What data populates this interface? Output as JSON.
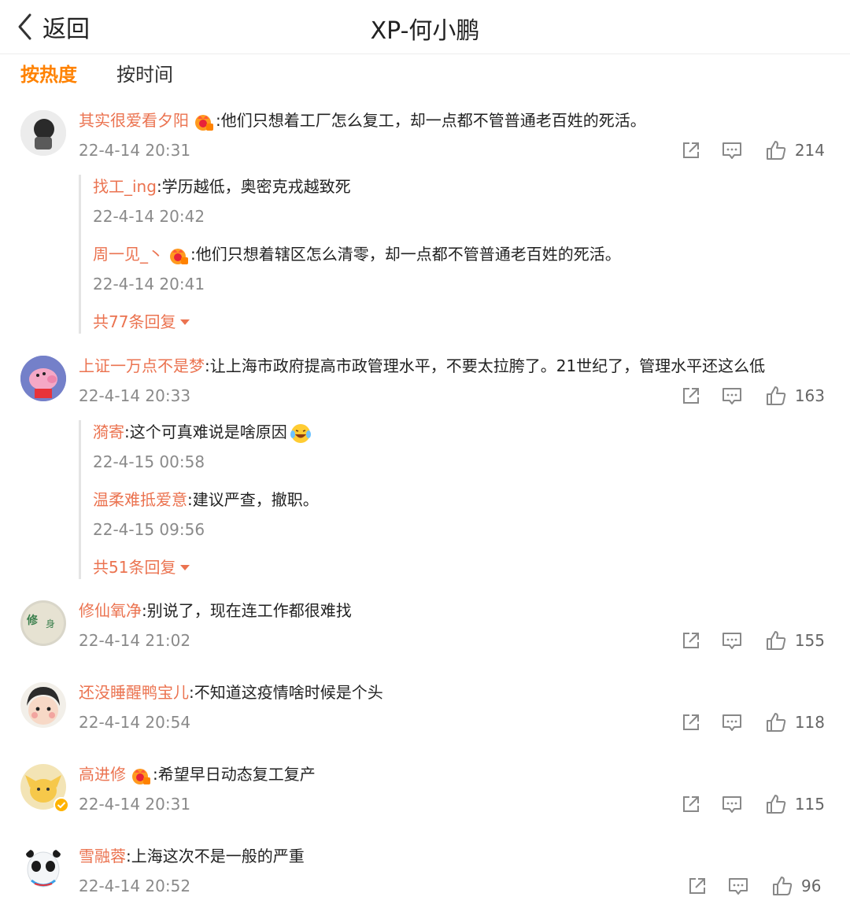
{
  "header": {
    "back_label": "返回",
    "title": "XP-何小鹏"
  },
  "sort": {
    "hot": "按热度",
    "time": "按时间"
  },
  "comments": [
    {
      "user": "其实很爱看夕阳",
      "text": ":他们只想着工厂怎么复工，却一点都不管普通老百姓的死活。",
      "time": "22-4-14 20:31",
      "likes": "214",
      "replies": [
        {
          "user": "找工_ing",
          "text": ":学历越低，奥密克戎越致死",
          "time": "22-4-14 20:42"
        },
        {
          "user": "周一见_丶",
          "text": ":他们只想着辖区怎么清零，却一点都不管普通老百姓的死活。",
          "time": "22-4-14 20:41"
        }
      ],
      "more": "共77条回复"
    },
    {
      "user": "上证一万点不是梦",
      "text": ":让上海市政府提高市政管理水平，不要太拉胯了。21世纪了，管理水平还这么低",
      "time": "22-4-14 20:33",
      "likes": "163",
      "replies": [
        {
          "user": "漪寄",
          "text": ":这个可真难说是啥原因",
          "time": "22-4-15 00:58"
        },
        {
          "user": "温柔难抵爱意",
          "text": ":建议严查，撤职。",
          "time": "22-4-15 09:56"
        }
      ],
      "more": "共51条回复"
    },
    {
      "user": "修仙氧净",
      "text": ":别说了，现在连工作都很难找",
      "time": "22-4-14 21:02",
      "likes": "155"
    },
    {
      "user": "还没睡醒鸭宝儿",
      "text": ":不知道这疫情啥时候是个头",
      "time": "22-4-14 20:54",
      "likes": "118"
    },
    {
      "user": "高进修",
      "text": ":希望早日动态复工复产",
      "time": "22-4-14 20:31",
      "likes": "115"
    },
    {
      "user": "雪融蓉",
      "text": ":上海这次不是一般的严重",
      "time": "22-4-14 20:52",
      "likes": "96"
    }
  ]
}
